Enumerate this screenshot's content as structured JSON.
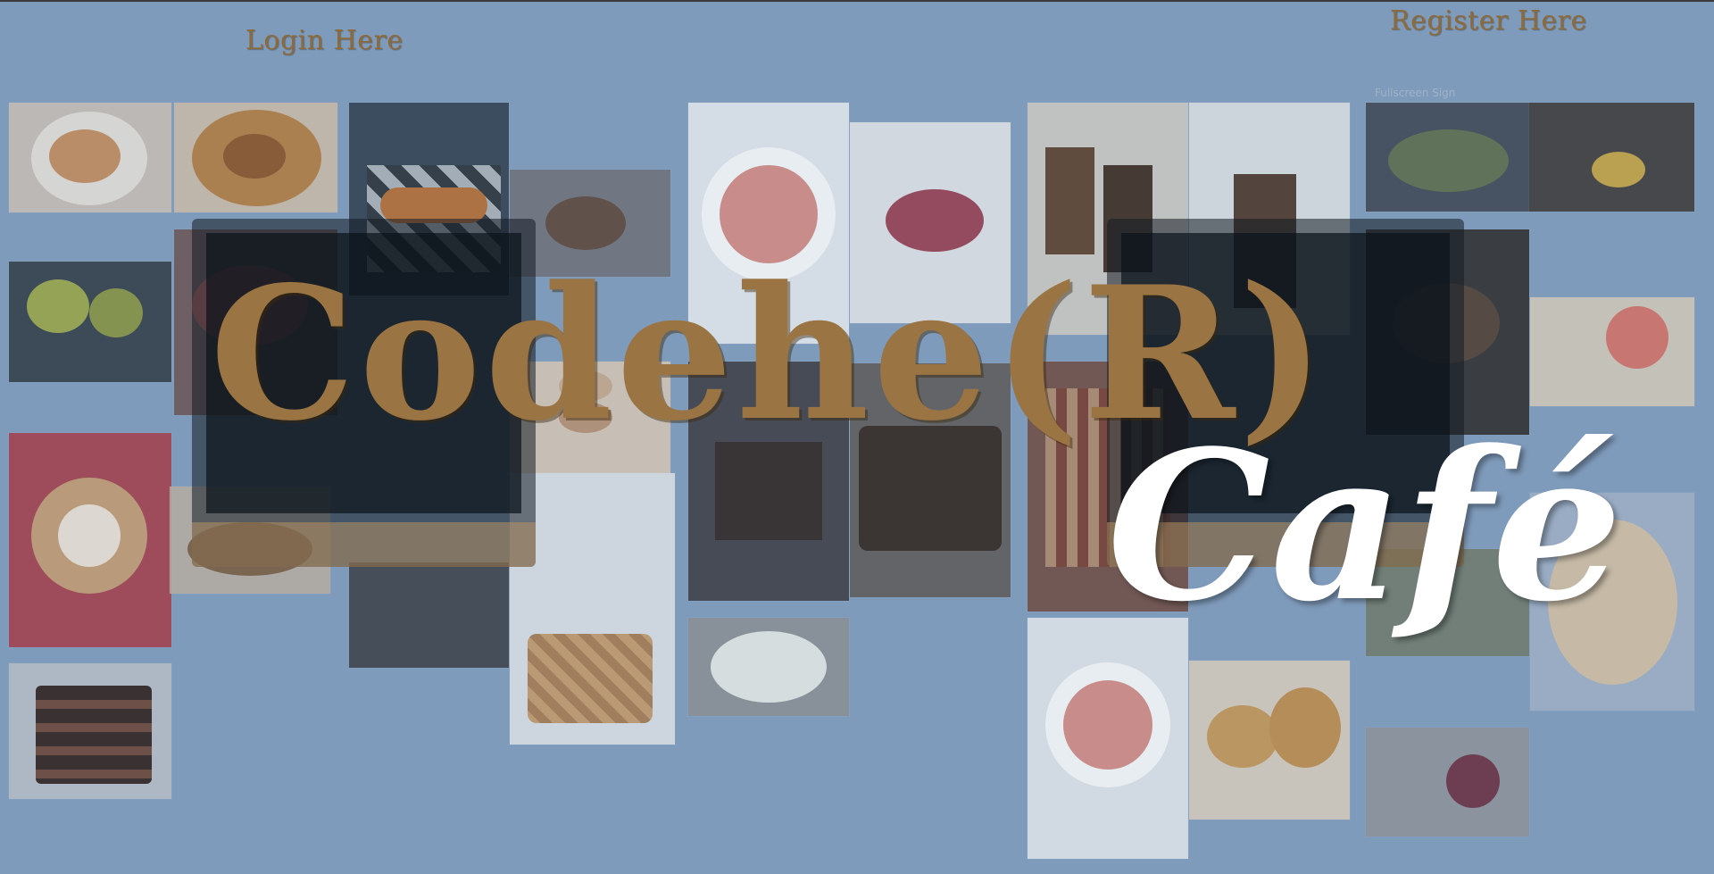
{
  "nav": {
    "login_label": "Login Here",
    "register_label": "Register Here"
  },
  "hero": {
    "title": "Codehe(R)",
    "subtitle": "Café"
  },
  "overlay": {
    "fullscreen_text": "Fullscreen Sign"
  },
  "colors": {
    "background": "#7f9bbb",
    "title_brown": "#9a7442",
    "subtitle_white": "#ffffff"
  },
  "gallery": {
    "images": [
      "spaghetti-icon",
      "tart-icon",
      "hotdogs-icon",
      "bread-icon",
      "salad-icon",
      "berry-tart-icon",
      "iced-coffee-icon",
      "coffee-glass-icon",
      "pan-meal-icon",
      "espresso-icon",
      "apples-icon",
      "laptop-icon",
      "cake-icon",
      "macarons-icon",
      "brownie-icon",
      "chocolate-cake-icon",
      "pie-icon",
      "pour-over-icon",
      "grapefruit-icon",
      "latte-art-icon",
      "dessert-icon",
      "coffee-machine-icon",
      "basket-icon",
      "green-salad-icon",
      "tomato-salad-icon",
      "cookies-icon",
      "berry-dessert-icon",
      "toast-icon",
      "tacos-icon",
      "layer-cake-icon"
    ]
  }
}
